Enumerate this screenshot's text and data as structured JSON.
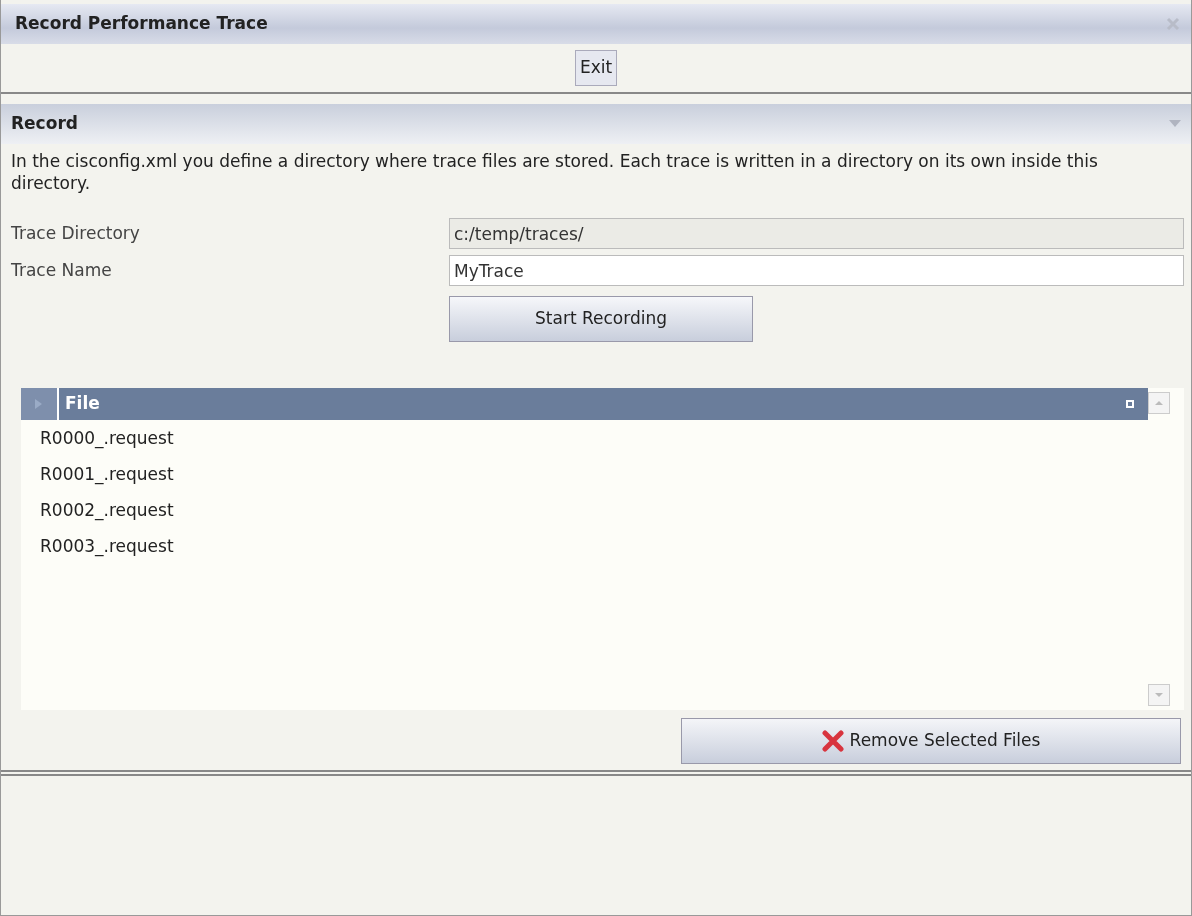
{
  "window": {
    "title": "Record Performance Trace"
  },
  "toolbar": {
    "buttons": [
      "Exit"
    ]
  },
  "section": {
    "title": "Record",
    "expanded": true,
    "description": "In the cisconfig.xml you define a directory where trace files are stored. Each trace is written in a directory on its own inside this directory.",
    "fields": [
      {
        "label": "Trace Directory",
        "value": "c:/temp/traces/",
        "disabled": true
      },
      {
        "label": "Trace Name",
        "value": "MyTrace",
        "disabled": false
      }
    ],
    "start_button": "Start Recording"
  },
  "table": {
    "columns": [
      "File"
    ],
    "rows": [
      {
        "file": "R0000_.request",
        "selected": false
      },
      {
        "file": "R0001_.request",
        "selected": false
      },
      {
        "file": "R0002_.request",
        "selected": false
      },
      {
        "file": "R0003_.request",
        "selected": false
      }
    ]
  },
  "remove_button": "Remove Selected Files"
}
